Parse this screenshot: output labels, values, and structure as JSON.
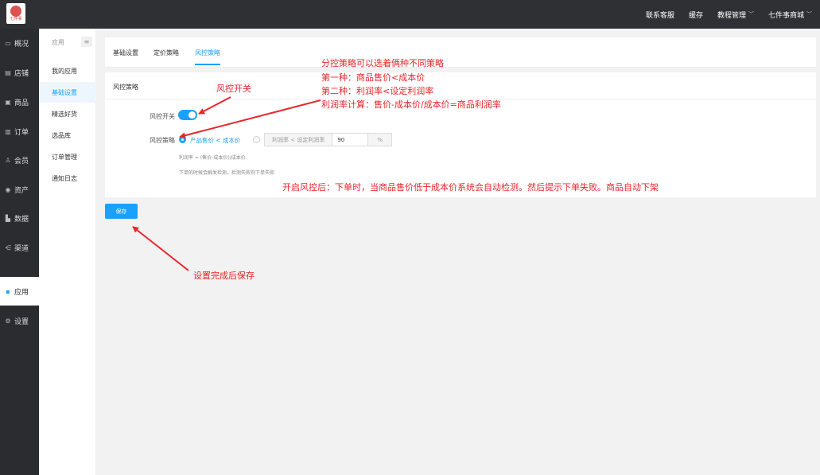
{
  "logo": {
    "text": "七件事"
  },
  "topnav": {
    "items": [
      {
        "label": "联系客服",
        "dropdown": false
      },
      {
        "label": "缓存",
        "dropdown": false
      },
      {
        "label": "教程管理",
        "dropdown": true
      },
      {
        "label": "七件事商城",
        "dropdown": true
      }
    ]
  },
  "sidebar": {
    "items": [
      {
        "label": "概况",
        "icon": "monitor-icon",
        "glyph": "▭"
      },
      {
        "label": "店铺",
        "icon": "store-icon",
        "glyph": "▤"
      },
      {
        "label": "商品",
        "icon": "goods-icon",
        "glyph": "▣"
      },
      {
        "label": "订单",
        "icon": "order-icon",
        "glyph": "▥"
      },
      {
        "label": "会员",
        "icon": "user-icon",
        "glyph": "♙"
      },
      {
        "label": "资产",
        "icon": "asset-icon",
        "glyph": "◉"
      },
      {
        "label": "数据",
        "icon": "data-icon",
        "glyph": "▙"
      },
      {
        "label": "渠道",
        "icon": "channel-icon",
        "glyph": "⋲"
      },
      {
        "label": "应用",
        "icon": "apps-icon",
        "glyph": "▪"
      },
      {
        "label": "设置",
        "icon": "gear-icon",
        "glyph": "⚙"
      }
    ]
  },
  "subnav": {
    "title": "应用",
    "menu_glyph": "≡",
    "items": [
      {
        "label": "我的应用"
      },
      {
        "label": "基础设置"
      },
      {
        "label": "精选好货"
      },
      {
        "label": "选品库"
      },
      {
        "label": "订单管理"
      },
      {
        "label": "通知日志"
      }
    ]
  },
  "tabs": [
    {
      "label": "基础设置"
    },
    {
      "label": "定价策略"
    },
    {
      "label": "风控策略"
    }
  ],
  "form": {
    "section_title": "风控策略",
    "switch_label": "风控开关",
    "switch_on": true,
    "strategy_label": "风控策略",
    "option1": "产品售价 < 成本价",
    "option2_prefix": "利润率 < 设定利润率",
    "option2_value": "90",
    "option2_suffix": "%",
    "hint1": "利润率 = (售价-成本价)/成本价",
    "hint2": "下单的时候会触发检测，检测失败则下单失败"
  },
  "save_button": "保存",
  "annotations": {
    "switch": "风控开关",
    "strategies_line1": "分控策略可以选着俩种不同策略",
    "strategies_line2": "第一种：商品售价<成本价",
    "strategies_line3": "第二种：利润率<设定利润率",
    "strategies_line4": "利润率计算：售价-成本价/成本价=商品利润率",
    "effect": "开启风控后：下单时，当商品售价低于成本价系统会自动检测。然后提示下单失败。商品自动下架",
    "save": "设置完成后保存"
  },
  "colors": {
    "accent": "#1aa1ff",
    "annotation": "#e8262c",
    "topbar": "#2f3033",
    "sidebar": "#2b2c2f"
  }
}
